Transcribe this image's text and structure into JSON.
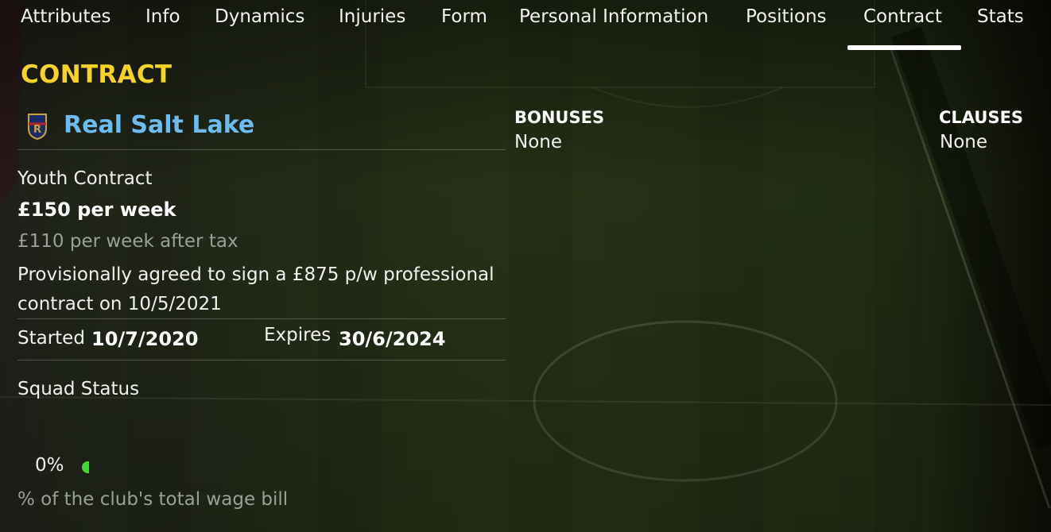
{
  "tabs": [
    {
      "label": "Attributes"
    },
    {
      "label": "Info"
    },
    {
      "label": "Dynamics"
    },
    {
      "label": "Injuries"
    },
    {
      "label": "Form"
    },
    {
      "label": "Personal Information"
    },
    {
      "label": "Positions"
    },
    {
      "label": "Contract",
      "active": true
    },
    {
      "label": "Stats"
    }
  ],
  "contract": {
    "section_title": "CONTRACT",
    "club": {
      "name": "Real Salt Lake",
      "badge_icon": "club-crest-icon"
    },
    "contract_type": "Youth Contract",
    "wage": "£150 per week",
    "wage_after_tax": "£110 per week after tax",
    "pro_contract_note": "Provisionally agreed to sign a £875 p/w professional contract on 10/5/2021",
    "started_label": "Started",
    "started_value": "10/7/2020",
    "expires_label": "Expires",
    "expires_value": "30/6/2024",
    "squad_status_label": "Squad Status",
    "wage_bill_percent": "0%",
    "wage_bill_label": "% of the club's total wage bill"
  },
  "bonuses": {
    "heading": "BONUSES",
    "value": "None"
  },
  "clauses": {
    "heading": "CLAUSES",
    "value": "None"
  },
  "colors": {
    "title": "#f5d327",
    "club_link": "#6cbcf0",
    "muted_text": "#9aa098",
    "indicator": "#46d63a",
    "pitch": "#2e3a1e"
  }
}
